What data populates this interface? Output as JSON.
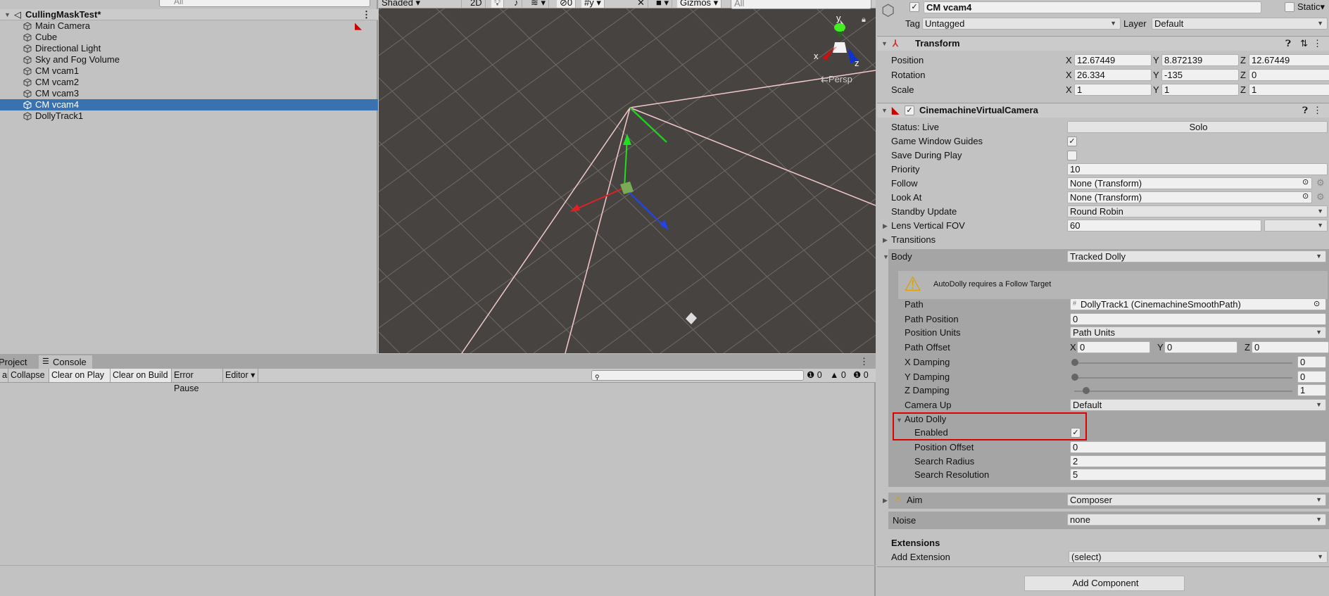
{
  "hierarchy": {
    "search_placeholder": "All",
    "scene": "CullingMaskTest*",
    "items": [
      "Main Camera",
      "Cube",
      "Directional Light",
      "Sky and Fog Volume",
      "CM vcam1",
      "CM vcam2",
      "CM vcam3",
      "CM vcam4",
      "DollyTrack1"
    ],
    "selected": "CM vcam4"
  },
  "scene_toolbar": {
    "shading": "Shaded",
    "mode_2d": "2D",
    "hidden_count": "0",
    "gizmos": "Gizmos",
    "search_placeholder": "All",
    "axis_y": "y",
    "axis_x": "x",
    "axis_z": "z",
    "persp": "Persp"
  },
  "console": {
    "tabs": [
      "Project",
      "Console"
    ],
    "buttons": [
      "ar",
      "Collapse",
      "Clear on Play",
      "Clear on Build",
      "Error Pause",
      "Editor"
    ],
    "error_count": "0",
    "warning_count": "0",
    "info_count": "0"
  },
  "inspector": {
    "name": "CM vcam4",
    "static_label": "Static",
    "tag_label": "Tag",
    "tag": "Untagged",
    "layer_label": "Layer",
    "layer": "Default",
    "transform": {
      "title": "Transform",
      "rows": [
        {
          "label": "Position",
          "x": "12.67449",
          "y": "8.872139",
          "z": "12.67449"
        },
        {
          "label": "Rotation",
          "x": "26.334",
          "y": "-135",
          "z": "0"
        },
        {
          "label": "Scale",
          "x": "1",
          "y": "1",
          "z": "1"
        }
      ],
      "x": "X",
      "y": "Y",
      "z": "Z"
    },
    "vcam": {
      "title": "CinemachineVirtualCamera",
      "status": "Status: Live",
      "solo": "Solo",
      "game_window_guides": "Game Window Guides",
      "game_window_guides_checked": true,
      "save_during_play": "Save During Play",
      "save_during_play_checked": false,
      "priority_label": "Priority",
      "priority": "10",
      "follow_label": "Follow",
      "follow": "None (Transform)",
      "lookat_label": "Look At",
      "lookat": "None (Transform)",
      "standby_label": "Standby Update",
      "standby": "Round Robin",
      "lens_label": "Lens Vertical FOV",
      "lens": "60",
      "transitions": "Transitions",
      "body_label": "Body",
      "body": "Tracked Dolly",
      "warning": "AutoDolly requires a Follow Target",
      "path_label": "Path",
      "path": "DollyTrack1 (CinemachineSmoothPath)",
      "path_position_label": "Path Position",
      "path_position": "0",
      "position_units_label": "Position Units",
      "position_units": "Path Units",
      "path_offset_label": "Path Offset",
      "path_offset": {
        "x": "0",
        "y": "0",
        "z": "0"
      },
      "x_damping_label": "X Damping",
      "x_damping": "0",
      "y_damping_label": "Y Damping",
      "y_damping": "0",
      "z_damping_label": "Z Damping",
      "z_damping": "1",
      "damping_max": 20,
      "camera_up_label": "Camera Up",
      "camera_up": "Default",
      "auto_dolly": "Auto Dolly",
      "enabled_label": "Enabled",
      "enabled": true,
      "position_offset_label": "Position Offset",
      "position_offset": "0",
      "search_radius_label": "Search Radius",
      "search_radius": "2",
      "search_resolution_label": "Search Resolution",
      "search_resolution": "5",
      "aim_label": "Aim",
      "aim": "Composer",
      "noise_label": "Noise",
      "noise": "none",
      "extensions": "Extensions",
      "add_extension_label": "Add Extension",
      "add_extension": "(select)"
    },
    "add_component": "Add Component",
    "highlight_color": "#e00000"
  }
}
